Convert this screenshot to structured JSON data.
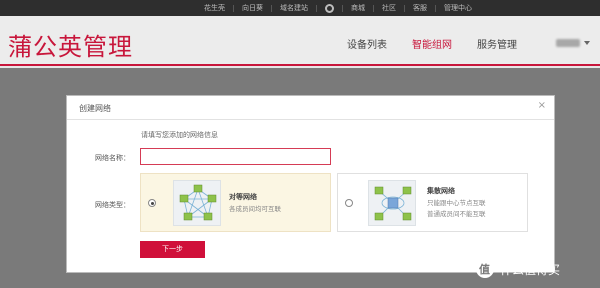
{
  "topbar": {
    "links": [
      "花生壳",
      "向日葵",
      "域名建站",
      "商城",
      "社区",
      "客服",
      "管理中心"
    ]
  },
  "header": {
    "brand": "蒲公英管理",
    "nav": [
      "设备列表",
      "智能组网",
      "服务管理"
    ],
    "active_nav": "智能组网"
  },
  "modal": {
    "title": "创建网络",
    "close": "×",
    "hint": "请填写您添加的网络信息",
    "name_label": "网络名称：",
    "name_value": "",
    "type_label": "网络类型：",
    "options": [
      {
        "title": "对等网络",
        "desc": "各成员间均可互联",
        "selected": true
      },
      {
        "title": "集散网络",
        "desc_lines": [
          "只能跟中心节点互联",
          "普通成员间不能互联"
        ],
        "selected": false
      }
    ],
    "next_button": "下一步"
  },
  "watermark": {
    "text": "什么值得买"
  },
  "colors": {
    "brand": "#c8163b",
    "button": "#d0103a",
    "selected_bg": "#fbf6e3"
  }
}
